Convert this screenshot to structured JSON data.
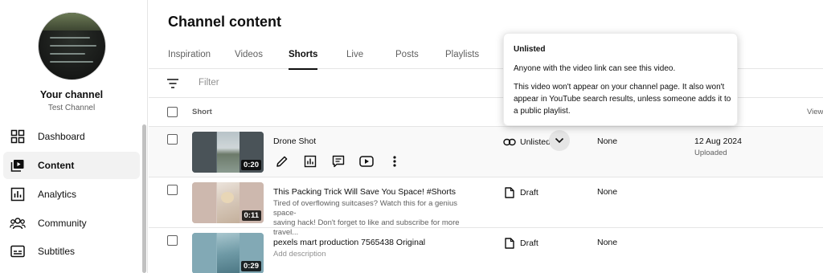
{
  "sidebar": {
    "channel_title": "Your channel",
    "channel_subtitle": "Test Channel",
    "items": [
      {
        "label": "Dashboard",
        "icon": "dashboard-icon",
        "active": false
      },
      {
        "label": "Content",
        "icon": "content-icon",
        "active": true
      },
      {
        "label": "Analytics",
        "icon": "analytics-icon",
        "active": false
      },
      {
        "label": "Community",
        "icon": "community-icon",
        "active": false
      },
      {
        "label": "Subtitles",
        "icon": "subtitles-icon",
        "active": false
      }
    ]
  },
  "main": {
    "title": "Channel content",
    "tabs": [
      {
        "label": "Inspiration",
        "active": false
      },
      {
        "label": "Videos",
        "active": false
      },
      {
        "label": "Shorts",
        "active": true
      },
      {
        "label": "Live",
        "active": false
      },
      {
        "label": "Posts",
        "active": false
      },
      {
        "label": "Playlists",
        "active": false
      }
    ],
    "filter_placeholder": "Filter",
    "columns": {
      "short": "Short",
      "views": "View"
    },
    "rows": [
      {
        "title": "Drone Shot",
        "duration": "0:20",
        "visibility": "Unlisted",
        "restrictions": "None",
        "date": "12 Aug 2024",
        "date_status": "Uploaded",
        "actions": [
          "edit-icon",
          "analytics-icon",
          "comments-icon",
          "youtube-icon",
          "more-options-icon"
        ]
      },
      {
        "title": "This Packing Trick Will Save You Space! #Shorts",
        "description_line1": "Tired of overflowing suitcases? Watch this for a genius space-",
        "description_line2": "saving hack! Don't forget to like and subscribe for more travel...",
        "duration": "0:11",
        "visibility": "Draft",
        "restrictions": "None"
      },
      {
        "title": "pexels mart production 7565438 Original",
        "description": "Add description",
        "duration": "0:29",
        "visibility": "Draft",
        "restrictions": "None"
      }
    ]
  },
  "tooltip": {
    "title": "Unlisted",
    "line1": "Anyone with the video link can see this video.",
    "line2": "This video won't appear on your channel page. It also won't appear in YouTube search results, unless someone adds it to a public playlist."
  },
  "colors": {
    "text_primary": "#0f0f0f",
    "text_secondary": "#606060",
    "active_bg": "#f2f2f2",
    "divider": "#e5e5e5"
  }
}
